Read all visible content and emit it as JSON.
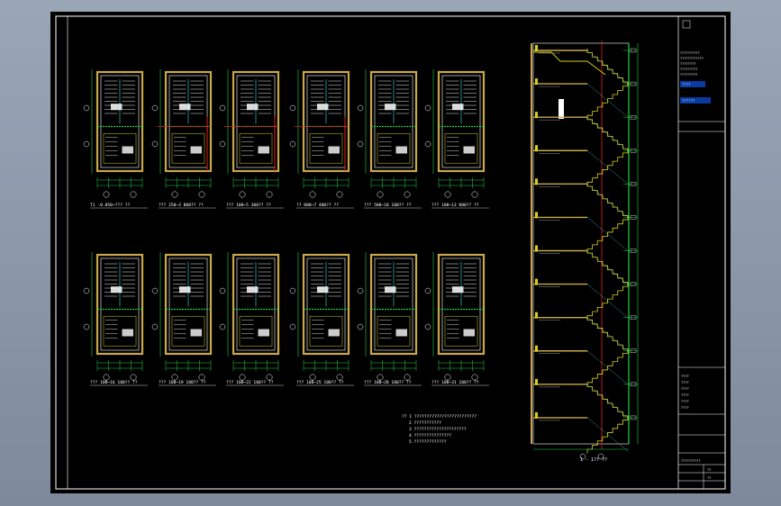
{
  "colors": {
    "background": "#8a96a8",
    "sheet": "#000000",
    "frame": "#ffffff",
    "wall": "#c8a84a",
    "dim": "#22d04a",
    "axis": "#e02020",
    "hatch": "#ffffff",
    "stair": "#d8d020",
    "cyan": "#40e0e0"
  },
  "plans": [
    {
      "label": "T1 -0.050~??? ??"
    },
    {
      "label": "??? 250~3 800?? ??"
    },
    {
      "label": "??? 100~5 300?? ??"
    },
    {
      "label": "?? 000~7 400?? ??"
    },
    {
      "label": "??? 500~10 100?? ??"
    },
    {
      "label": "??? 100~13 000?? ??"
    },
    {
      "label": "??? 100~16 100?? ??"
    },
    {
      "label": "??? 100~19 100?? ??"
    },
    {
      "label": "??? 100~22 100?? ??"
    },
    {
      "label": "??? 100~25 100?? ??"
    },
    {
      "label": "??? 100~28 100?? ??"
    },
    {
      "label": "??? 100~31 100?? ??"
    }
  ],
  "notes": {
    "lines": [
      "?? 1 ?????????????????????????",
      "2 ???????????",
      "3 ?????????????????????",
      "4 ???????????????",
      "5 ?????????????"
    ]
  },
  "section": {
    "label": "1 - 1??  ??"
  },
  "title_block": {
    "lines_top": [
      "??????????",
      "????????????",
      "????????",
      "?????????",
      "?????????"
    ],
    "badge1": "????",
    "badge2": "??????",
    "rows": [
      "????",
      "????",
      "????",
      "????",
      "????",
      "????"
    ],
    "footer": "??????????",
    "code": "??",
    "sheet_no": "??"
  }
}
